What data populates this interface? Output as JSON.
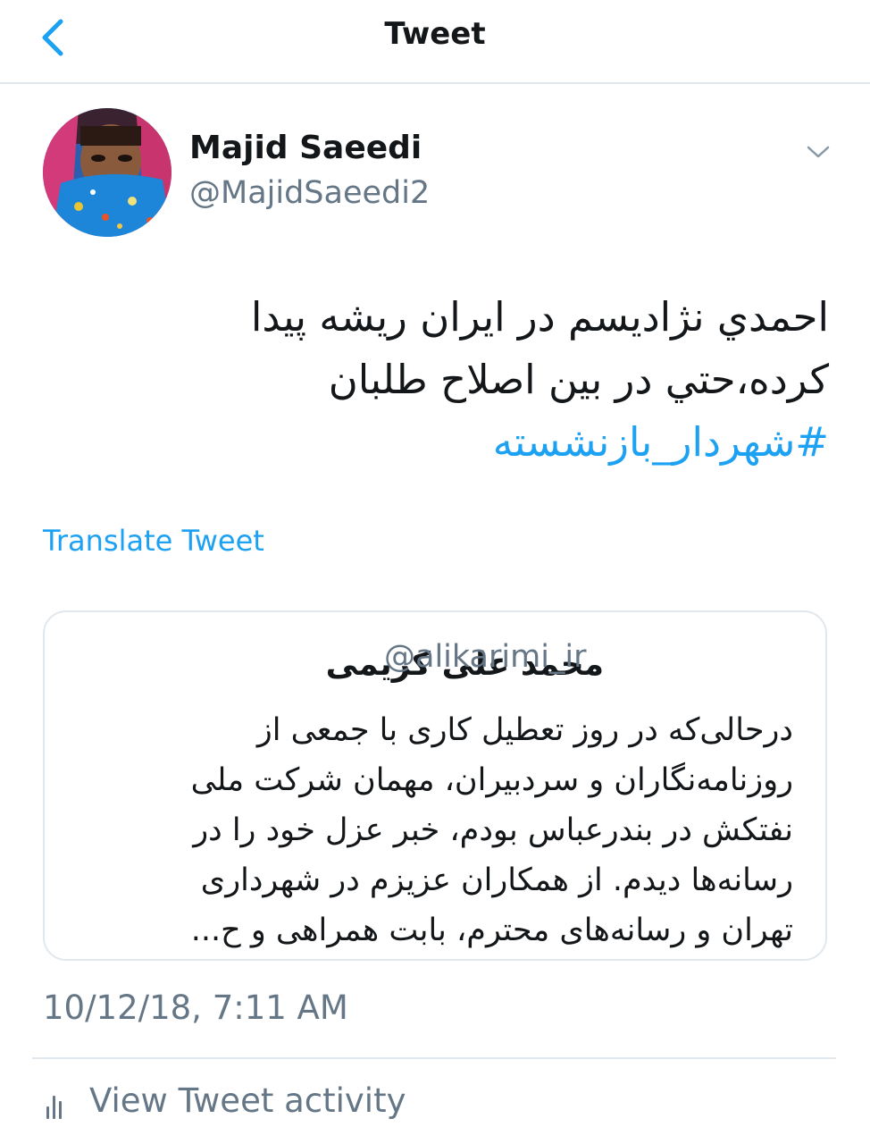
{
  "header": {
    "title": "Tweet"
  },
  "tweet": {
    "author_name": "Majid Saeedi",
    "author_handle": "@MajidSaeedi2",
    "text_lines": [
      "احمدي نژاديسم در ايران ريشه پيدا",
      "كرده،حتي در بين اصلاح طلبان"
    ],
    "hashtag": "#شهردار_بازنشسته",
    "translate_label": "Translate Tweet",
    "timestamp": "10/12/18, 7:11 AM",
    "activity_label": "View Tweet activity"
  },
  "quoted_tweet": {
    "author_name": "محمد علی کریمی",
    "author_handle": "@alikarimi_ir",
    "text_lines": [
      "درحالی‌که در روز تعطیل کاری با جمعی از",
      "روزنامه‌نگاران و سردبیران، مهمان شرکت ملی",
      "نفتکش در بندرعباس بودم، خبر عزل خود را در",
      "رسانه‌ها دیدم. از همکاران عزیزم در شهرداری",
      "تهران و رسانه‌های محترم، بابت همراهی و ح..."
    ]
  },
  "colors": {
    "accent": "#1da1f2",
    "text": "#14171a",
    "secondary": "#657786",
    "border": "#e1e8ed"
  },
  "icons": {
    "back": "chevron-left-icon",
    "more": "chevron-down-icon",
    "activity": "bar-chart-icon"
  }
}
